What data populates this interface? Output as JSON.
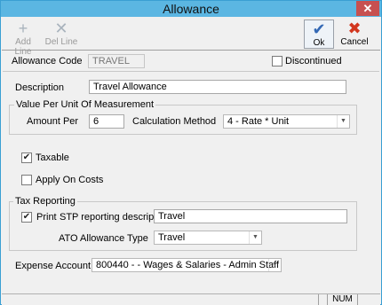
{
  "window": {
    "title": "Allowance",
    "close_glyph": "✕"
  },
  "toolbar": {
    "add_line": {
      "label": "Add Line",
      "icon": "add-line-icon",
      "glyph": "+"
    },
    "del_line": {
      "label": "Del Line",
      "icon": "delete-line-icon",
      "glyph": "✕"
    },
    "ok": {
      "label": "Ok",
      "icon": "checkmark-icon",
      "glyph": "✔"
    },
    "cancel": {
      "label": "Cancel",
      "icon": "cancel-x-icon",
      "glyph": "✖"
    }
  },
  "form": {
    "allowance_code_label": "Allowance Code",
    "allowance_code_value": "TRAVEL",
    "discontinued_label": "Discontinued",
    "discontinued_checked": false,
    "description_label": "Description",
    "description_value": "Travel Allowance",
    "value_group_title": "Value Per Unit Of Measurement",
    "amount_per_label": "Amount Per",
    "amount_per_value": "6",
    "calc_method_label": "Calculation Method",
    "calc_method_value": "4 - Rate * Unit",
    "taxable_label": "Taxable",
    "taxable_checked": true,
    "apply_on_costs_label": "Apply On Costs",
    "apply_on_costs_checked": false,
    "tax_group_title": "Tax Reporting",
    "print_label": "Print",
    "print_checked": true,
    "stp_label": "STP reporting description",
    "stp_value": "Travel",
    "ato_label": "ATO Allowance Type",
    "ato_value": "Travel",
    "expense_label": "Expense Account",
    "expense_value": "800440 -  - Wages & Salaries - Admin Staff",
    "check_glyph": "✔",
    "dropdown_arrow_glyph": "▼"
  },
  "status": {
    "num": "NUM"
  },
  "colors": {
    "titlebar": "#5bb6e2",
    "close": "#c75050",
    "ok_icon": "#3469b5",
    "cancel_icon": "#d2361e"
  }
}
